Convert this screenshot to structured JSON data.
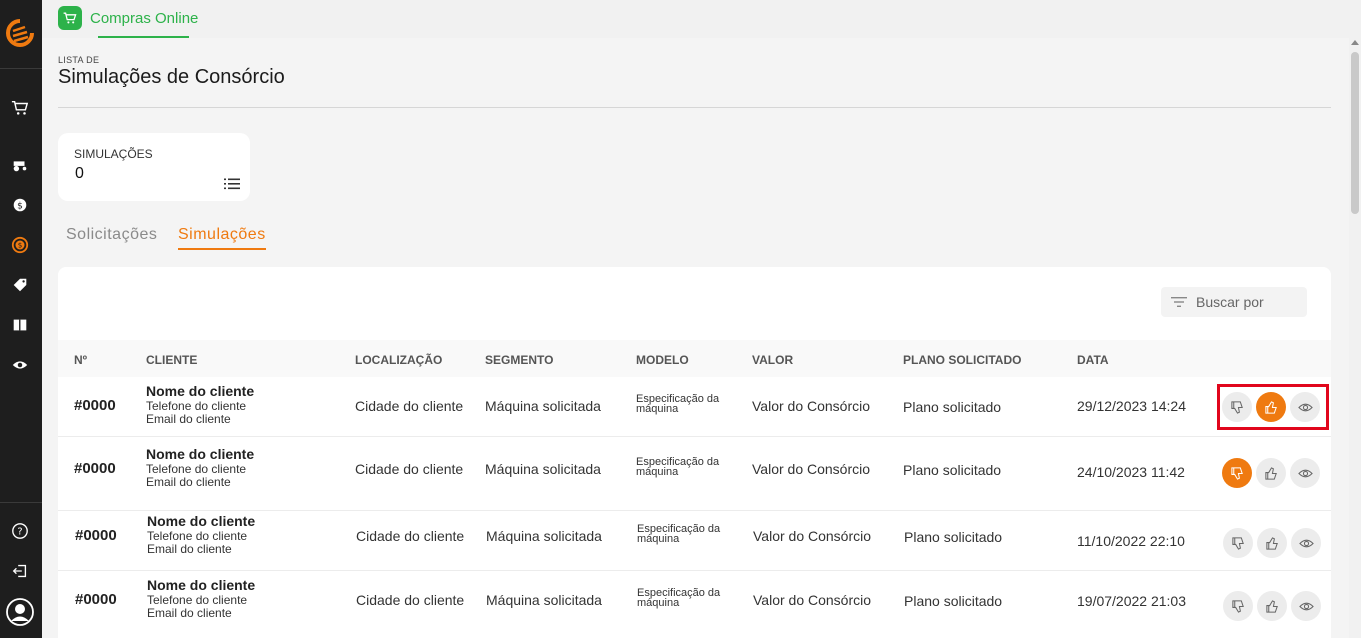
{
  "top_tab": {
    "label": "Compras Online"
  },
  "page": {
    "eyebrow": "LISTA DE",
    "title": "Simulações de Consórcio"
  },
  "stat": {
    "label": "SIMULAÇÕES",
    "value": "0"
  },
  "tabs": [
    {
      "label": "Solicitações"
    },
    {
      "label": "Simulações"
    }
  ],
  "search": {
    "placeholder": "Buscar por"
  },
  "columns": [
    "Nº",
    "CLIENTE",
    "LOCALIZAÇÃO",
    "SEGMENTO",
    "MODELO",
    "VALOR",
    "PLANO SOLICITADO",
    "DATA"
  ],
  "rows": [
    {
      "number": "#0000",
      "client_name": "Nome do cliente",
      "client_phone": "Telefone do cliente",
      "client_email": "Email do cliente",
      "location": "Cidade do cliente",
      "segment": "Máquina solicitada",
      "model": "Especificação da máquina",
      "value": "Valor do Consórcio",
      "plan": "Plano solicitado",
      "date": "29/12/2023 14:24",
      "status": "approved"
    },
    {
      "number": "#0000",
      "client_name": "Nome do cliente",
      "client_phone": "Telefone do cliente",
      "client_email": "Email do cliente",
      "location": "Cidade do cliente",
      "segment": "Máquina solicitada",
      "model": "Especificação da máquina",
      "value": "Valor do Consórcio",
      "plan": "Plano solicitado",
      "date": "24/10/2023 11:42",
      "status": "rejected"
    },
    {
      "number": "#0000",
      "client_name": "Nome do cliente",
      "client_phone": "Telefone do cliente",
      "client_email": "Email do cliente",
      "location": "Cidade do cliente",
      "segment": "Máquina solicitada",
      "model": "Especificação da máquina",
      "value": "Valor do Consórcio",
      "plan": "Plano solicitado",
      "date": "11/10/2022 22:10",
      "status": "none"
    },
    {
      "number": "#0000",
      "client_name": "Nome do cliente",
      "client_phone": "Telefone do cliente",
      "client_email": "Email do cliente",
      "location": "Cidade do cliente",
      "segment": "Máquina solicitada",
      "model": "Especificação da máquina",
      "value": "Valor do Consórcio",
      "plan": "Plano solicitado",
      "date": "19/07/2022 21:03",
      "status": "none"
    }
  ],
  "colors": {
    "accent": "#ef7a10",
    "brand_green": "#2db24a",
    "sidebar": "#1e1e1e",
    "highlight": "#e1061c"
  },
  "sidebar_icons": [
    "logo-icon",
    "cart-icon",
    "tractor-icon",
    "money-icon",
    "consortium-icon",
    "tag-icon",
    "ticket-icon",
    "eye-icon",
    "help-icon",
    "logout-icon",
    "user-icon"
  ]
}
